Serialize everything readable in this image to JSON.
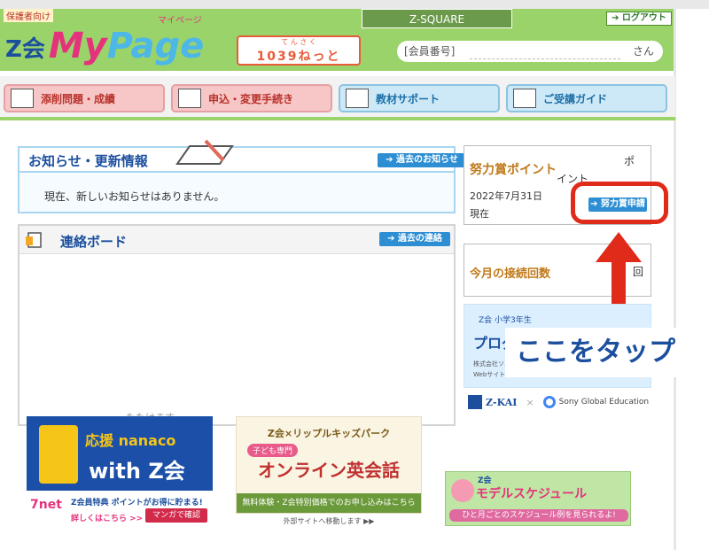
{
  "header": {
    "guardian_tag": "保護者向け",
    "logo_z": "Z会",
    "logo_my": "My",
    "logo_page": "Page",
    "logo_kana": "マイページ",
    "net_badge_small": "て ん さ く",
    "net_badge_big": "1039ねっと",
    "zsquare": "Z-SQUARE",
    "logout": "➔ ログアウト",
    "member_label": "[会員番号]",
    "member_suffix": "さん"
  },
  "nav": {
    "items": [
      {
        "label": "添削問題・成績",
        "icon": "exam-sheet-icon"
      },
      {
        "label": "申込・変更手続き",
        "icon": "form-icon"
      },
      {
        "label": "教材サポート",
        "icon": "book-icon"
      },
      {
        "label": "ご受講ガイド",
        "icon": "beginner-mark-icon"
      }
    ]
  },
  "notice": {
    "title": "お知らせ・更新情報",
    "past_button": "➔ 過去のお知らせ",
    "message": "現在、新しいお知らせはありません。"
  },
  "board": {
    "title": "連絡ボード",
    "past_button": "➔ 過去の連絡",
    "faint_text": "たたけます"
  },
  "effort": {
    "title": "努力賞ポイント",
    "trunc1": "イント",
    "trunc2": "ポ",
    "date": "2022年7月31日",
    "now": "現在",
    "apply_button": "➔ 努力賞申請"
  },
  "monthly": {
    "title": "今月の接続回数",
    "trunc": "回"
  },
  "adbox": {
    "label": "Z会 小学3年生",
    "big": "プログ",
    "small1": "株式会社ソニー",
    "small2": "Webサイトに"
  },
  "tap_label": "ここをタップ",
  "logos": {
    "zkai": "Z-KAI",
    "times": "×",
    "sge": "Sony Global Education"
  },
  "banners": {
    "nanaco_t1": "応援 nanaco",
    "nanaco_t2": "with Z会",
    "nanaco_logo": "7net",
    "nanaco_l1": "Z会員特典 ポイントがお得に貯まる!",
    "nanaco_l2": "詳しくはこちら >>",
    "nanaco_manga": "マンガで確認",
    "english_t1": "Z会×リップルキッズパーク",
    "english_kids": "子ども専門",
    "english_t2": "オンライン英会話",
    "english_foot": "無料体験・Z会特別価格でのお申し込みはこちら",
    "english_note": "外部サイトへ移動します ▶▶",
    "schedule_z": "Z会",
    "schedule_t1": "モデルスケジュール",
    "schedule_t2": "ひと月ごとのスケジュール例を見られるよ!"
  },
  "colors": {
    "header_green": "#9bd36b",
    "highlight_red": "#e02a1a",
    "button_blue": "#2d8ed3",
    "title_navy": "#1b4f9e"
  }
}
